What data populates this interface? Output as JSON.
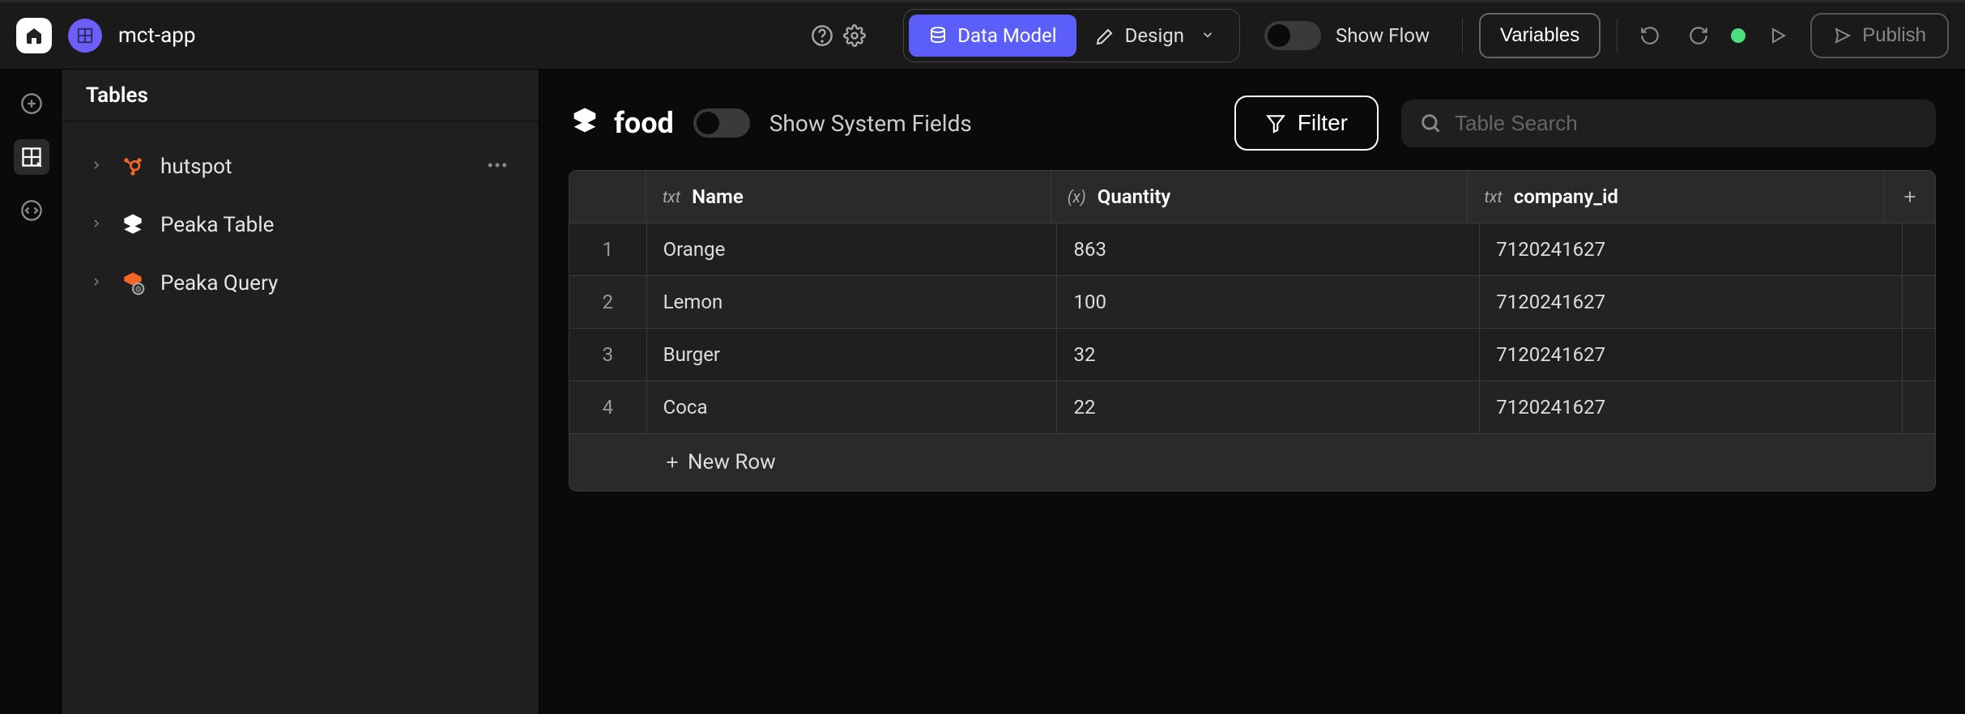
{
  "header": {
    "app_name": "mct-app",
    "modes": {
      "data_model": "Data Model",
      "design": "Design"
    },
    "show_flow_label": "Show Flow",
    "variables_label": "Variables",
    "publish_label": "Publish"
  },
  "sidebar": {
    "title": "Tables",
    "items": [
      {
        "label": "hutspot"
      },
      {
        "label": "Peaka Table"
      },
      {
        "label": "Peaka Query"
      }
    ]
  },
  "main": {
    "table_name": "food",
    "show_system_fields_label": "Show System Fields",
    "filter_label": "Filter",
    "search_placeholder": "Table Search",
    "new_row_label": "New Row",
    "columns": [
      {
        "type": "txt",
        "label": "Name"
      },
      {
        "type": "(x)",
        "label": "Quantity"
      },
      {
        "type": "txt",
        "label": "company_id"
      }
    ],
    "rows": [
      {
        "num": "1",
        "name": "Orange",
        "quantity": "863",
        "company_id": "7120241627"
      },
      {
        "num": "2",
        "name": "Lemon",
        "quantity": "100",
        "company_id": "7120241627"
      },
      {
        "num": "3",
        "name": "Burger",
        "quantity": "32",
        "company_id": "7120241627"
      },
      {
        "num": "4",
        "name": "Coca",
        "quantity": "22",
        "company_id": "7120241627"
      }
    ]
  }
}
